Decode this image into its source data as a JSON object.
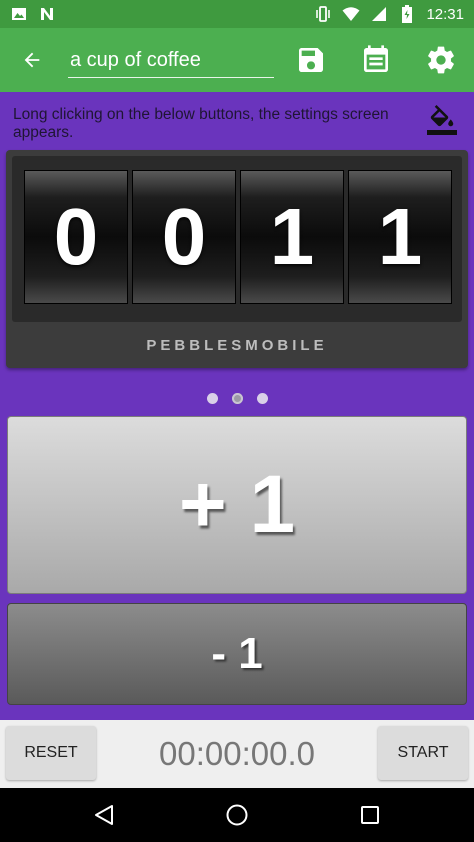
{
  "status_bar": {
    "time": "12:31",
    "left_icons": [
      "image-icon",
      "n-icon"
    ],
    "right_icons": [
      "vibrate-icon",
      "wifi-icon",
      "signal-icon",
      "battery-icon"
    ]
  },
  "app_bar": {
    "title_value": "a cup of coffee",
    "color": "#4caf50",
    "actions": [
      "save-icon",
      "calendar-note-icon",
      "gear-icon"
    ]
  },
  "hint": {
    "text": "Long clicking on the below buttons, the settings screen appears."
  },
  "counter": {
    "digits": [
      "0",
      "0",
      "1",
      "1"
    ],
    "brand": "PEBBLESMOBILE"
  },
  "pager": {
    "count": 3,
    "active_index": 1
  },
  "buttons": {
    "increment_label": "+ 1",
    "decrement_label": "- 1"
  },
  "timer": {
    "reset_label": "RESET",
    "display": "00:00:00.0",
    "start_label": "START"
  },
  "nav": [
    "back-icon",
    "home-icon",
    "recents-icon"
  ],
  "colors": {
    "background": "#6a34bd",
    "status_bar": "#3f9a3f",
    "app_bar": "#4caf50"
  }
}
